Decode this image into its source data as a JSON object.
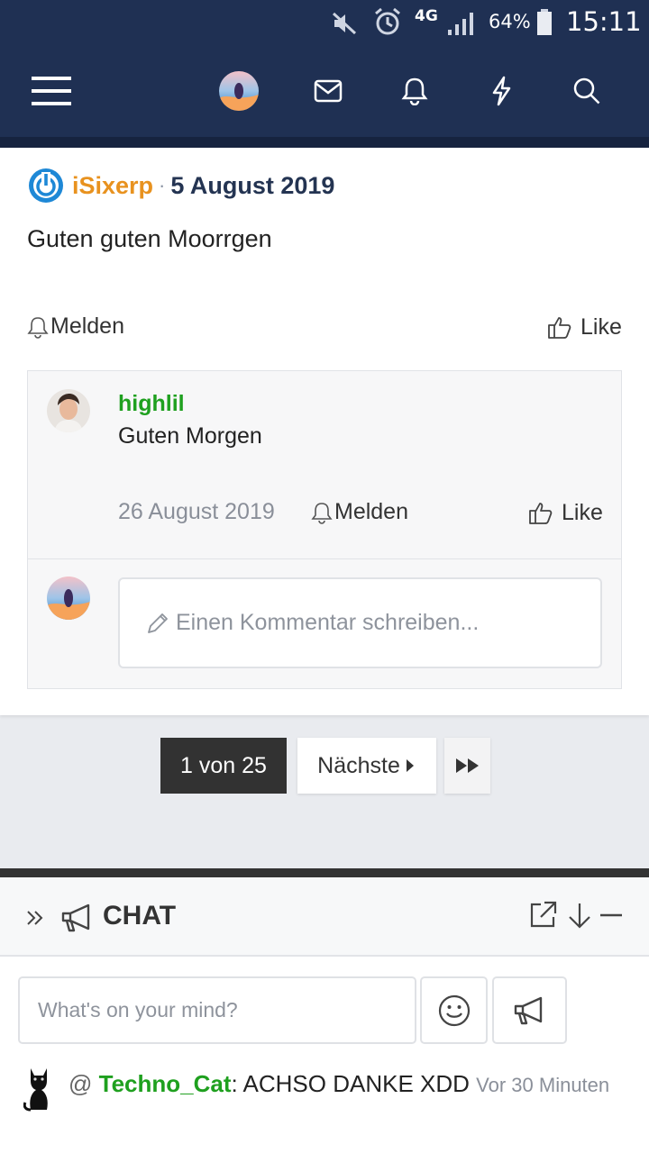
{
  "status_bar": {
    "network": "4G",
    "battery": "64%",
    "time": "15:11"
  },
  "post": {
    "author": "iSixerp",
    "separator": "·",
    "date": "5 August 2019",
    "body": "Guten guten Moorrgen",
    "report_label": "Melden",
    "like_label": "Like"
  },
  "comment": {
    "user": "highlil",
    "text": "Guten Morgen",
    "date": "26 August 2019",
    "report_label": "Melden",
    "like_label": "Like"
  },
  "comment_input": {
    "placeholder": "Einen Kommentar schreiben..."
  },
  "pagination": {
    "current": "1 von 25",
    "next_label": "Nächste"
  },
  "chat": {
    "title": "CHAT",
    "input_placeholder": "What's on your mind?",
    "message": {
      "at": "@",
      "user": "Techno_Cat",
      "text": ": ACHSO DANKE XDD",
      "time": "Vor 30 Minuten"
    }
  },
  "colors": {
    "header": "#1f3053",
    "author": "#e8921f",
    "username": "#1fa01f",
    "pagination_current": "#323232"
  },
  "icons": [
    "menu-icon",
    "avatar",
    "mail-icon",
    "bell-icon",
    "bolt-icon",
    "search-icon",
    "power-icon",
    "pencil-icon",
    "thumbs-up-icon",
    "megaphone-icon",
    "smiley-icon",
    "popout-icon",
    "arrow-down-icon",
    "minimize-icon",
    "fast-forward-icon"
  ]
}
